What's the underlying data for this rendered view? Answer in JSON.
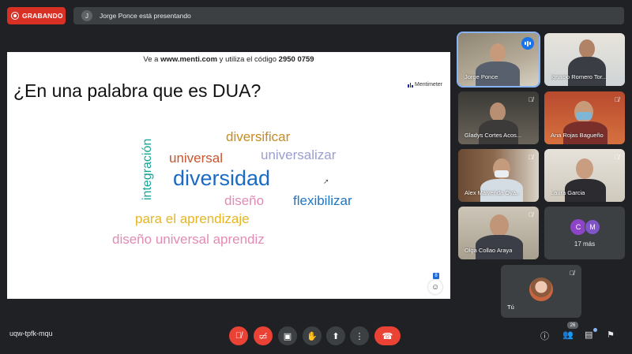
{
  "recording": {
    "label": "GRABANDO"
  },
  "presenting": {
    "avatar_initial": "J",
    "text": "Jorge Ponce está presentando"
  },
  "slide": {
    "instruction_prefix": "Ve a ",
    "site": "www.menti.com",
    "instruction_middle": " y utiliza el código ",
    "code": "2950 0759",
    "question": "¿En una palabra que es DUA?",
    "brand": "Mentimeter",
    "words": [
      "integración",
      "diversificar",
      "universal",
      "universalizar",
      "diversidad",
      "diseño",
      "flexibilizar",
      "para el aprendizaje",
      "diseño universal aprendiz"
    ],
    "corner_badge": "8"
  },
  "participants": [
    {
      "name": "Jorge Ponce",
      "muted": false,
      "speaking": true
    },
    {
      "name": "Ignacio Romero Tor...",
      "muted": false
    },
    {
      "name": "Gladys Cortes Acos...",
      "muted": true
    },
    {
      "name": "Ana Rojas Bagueño",
      "muted": true
    },
    {
      "name": "Alex Malvenda Oya...",
      "muted": true
    },
    {
      "name": "Laura Garcia",
      "muted": true
    },
    {
      "name": "Olga Collao Araya",
      "muted": true
    }
  ],
  "more": {
    "initial1": "C",
    "initial2": "M",
    "label": "17 más"
  },
  "self": {
    "label": "Tú"
  },
  "footer": {
    "meeting_code": "uqw-tpfk-mqu",
    "people_count": "26"
  },
  "colors": {
    "accent_red": "#ea4335",
    "speaking_blue": "#1a73e8",
    "background": "#202124"
  }
}
